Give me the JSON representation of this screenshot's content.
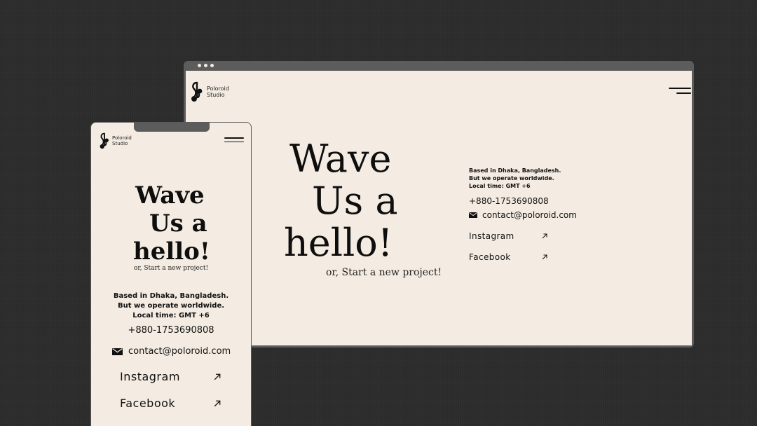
{
  "brand": {
    "line1": "Poloroid",
    "line2": "Studio"
  },
  "hero": {
    "headline_lines": [
      "Wave",
      "Us a",
      "hello!"
    ],
    "subtitle": "or, Start a new project!"
  },
  "contact": {
    "based_lines": [
      "Based in Dhaka, Bangladesh.",
      "But we operate worldwide.",
      "Local time: GMT +6"
    ],
    "phone": "+880-1753690808",
    "email": "contact@poloroid.com"
  },
  "social": [
    {
      "label": "Instagram",
      "icon": "arrow-up-right-icon"
    },
    {
      "label": "Facebook",
      "icon": "arrow-up-right-icon"
    }
  ],
  "icons": {
    "logo": "poloroid-logo-icon",
    "menu": "hamburger-menu-icon",
    "email": "envelope-icon",
    "window_dots": "window-dots"
  },
  "colors": {
    "background": "#2b2b2b",
    "frame": "#5c5c5c",
    "page": "#f4ece2",
    "text": "#111111"
  }
}
